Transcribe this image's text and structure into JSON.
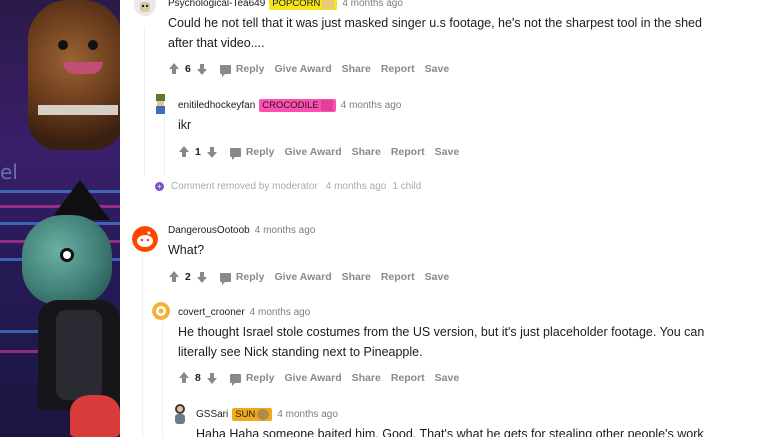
{
  "comments": [
    {
      "user": "Psychological-Tea649",
      "flair": "POPCORN",
      "flair_color": "#f5e51a",
      "time": "4 months ago",
      "body": [
        "Could he not tell that it was just masked singer u.s footage, he's not the sharpest tool in the shed",
        "after that video...."
      ],
      "score": "6"
    },
    {
      "user": "enitiledhockeyfan",
      "flair": "CROCODILE",
      "flair_color": "#ff4fb0",
      "time": "4 months ago",
      "body": [
        "ikr"
      ],
      "score": "1"
    },
    {
      "user": "DangerousOotoob",
      "flair": "",
      "time": "4 months ago",
      "body": [
        "What?"
      ],
      "score": "2"
    },
    {
      "user": "covert_crooner",
      "flair": "",
      "time": "4 months ago",
      "body": [
        "He thought Israel stole costumes from the US version, but it's just placeholder footage. You can",
        "literally see Nick standing next to Pineapple."
      ],
      "score": "8"
    },
    {
      "user": "GSSari",
      "flair": "SUN",
      "flair_color": "#f0a91a",
      "time": "4 months ago",
      "body": [
        "Haha Haha someone baited him. Good. That's what he gets for stealing other people's work"
      ]
    }
  ],
  "actions": {
    "reply": "Reply",
    "give_award": "Give Award",
    "share": "Share",
    "report": "Report",
    "save": "Save"
  },
  "removed": {
    "text": "Comment removed by moderator",
    "time": "4 months ago",
    "children": "1 child"
  },
  "colors": {
    "meta_gray": "#7c7c7c",
    "action_gray": "#878a8c",
    "removed_gray": "#a8aaab",
    "removed_icon": "#7b4fc9"
  },
  "banner": {
    "sign_text": "el"
  }
}
